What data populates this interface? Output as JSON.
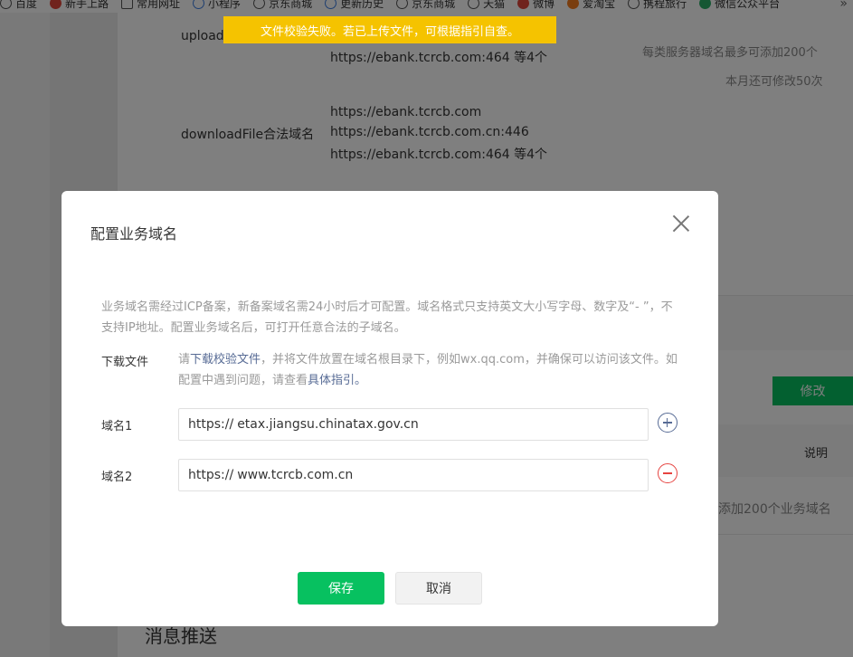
{
  "bookmarks": [
    {
      "label": "百度",
      "icon": "globe-icon"
    },
    {
      "label": "新手上路",
      "icon": "firefox-icon"
    },
    {
      "label": "常用网址",
      "icon": "folder-icon"
    },
    {
      "label": "小程序",
      "icon": "miniprogram-icon"
    },
    {
      "label": "京东商城",
      "icon": "globe-icon"
    },
    {
      "label": "更新历史",
      "icon": "sync-icon"
    },
    {
      "label": "京东商城",
      "icon": "globe-icon"
    },
    {
      "label": "天猫",
      "icon": "globe-icon"
    },
    {
      "label": "微博",
      "icon": "weibo-icon"
    },
    {
      "label": "爱淘宝",
      "icon": "taobao-icon"
    },
    {
      "label": "携程旅行",
      "icon": "globe-icon"
    },
    {
      "label": "微信公众平台",
      "icon": "wechat-icon"
    }
  ],
  "bookmarks_more": "»",
  "toast": "文件校验失败。若已上传文件，可根据指引自查。",
  "background_page": {
    "upload_label": "upload",
    "upload_value_line": "https://ebank.tcrcb.com:464 等4个",
    "limit_note": "每类服务器域名最多可添加200个",
    "remaining_note": "本月还可修改50次",
    "download_label": "downloadFile合法域名",
    "download_values": [
      "https://ebank.tcrcb.com",
      "https://ebank.tcrcb.com.cn:446",
      "https://ebank.tcrcb.com:464 等4个"
    ],
    "modify_button": "修改",
    "explain_header": "说明",
    "business_limit_note": "添加200个业务域名",
    "message_push_heading": "消息推送"
  },
  "dialog": {
    "title": "配置业务域名",
    "notice": "业务域名需经过ICP备案，新备案域名需24小时后才可配置。域名格式只支持英文大小写字母、数字及“- ”，不支持IP地址。配置业务域名后，可打开任意合法的子域名。",
    "download_label": "下载文件",
    "download_desc_1": "请",
    "download_link": "下载校验文件",
    "download_desc_2": "，并将文件放置在域名根目录下，例如wx.qq.com，并确保可以访问该文件。如配置中遇到问题，请查看",
    "guide_link": "具体指引。",
    "domains": [
      {
        "label": "域名1",
        "prefix": "https://",
        "value": "etax.jiangsu.chinatax.gov.cn",
        "action": "add"
      },
      {
        "label": "域名2",
        "prefix": "https://",
        "value": "www.tcrcb.com.cn",
        "action": "remove"
      }
    ],
    "save_label": "保存",
    "cancel_label": "取消"
  },
  "colors": {
    "primary_green": "#07c160",
    "toast_yellow": "#f5c300",
    "link_blue": "#576b95",
    "remove_red": "#e64340"
  }
}
